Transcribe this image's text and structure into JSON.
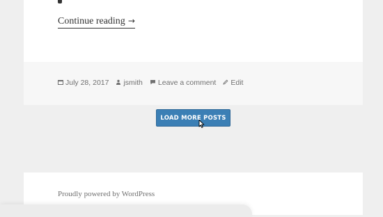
{
  "post": {
    "continue_label": "Continue reading",
    "continue_arrow": "→",
    "meta": {
      "date": "July 28, 2017",
      "author": "jsmith",
      "comment_label": "Leave a comment",
      "edit_label": "Edit"
    }
  },
  "pagination": {
    "load_more_label": "LOAD MORE POSTS"
  },
  "site_footer": {
    "powered_by": "Proudly powered by WordPress"
  },
  "colors": {
    "page_bg": "#efefef",
    "card_bg": "#ffffff",
    "footer_meta_bg": "#f7f7f7",
    "button_bg": "#3b7fb5",
    "text_dark": "#333333",
    "text_muted": "#707070"
  },
  "icons": {
    "date": "calendar-icon",
    "author": "user-icon",
    "comment": "comment-icon",
    "edit": "pencil-icon",
    "cursor": "mouse-pointer-icon"
  }
}
